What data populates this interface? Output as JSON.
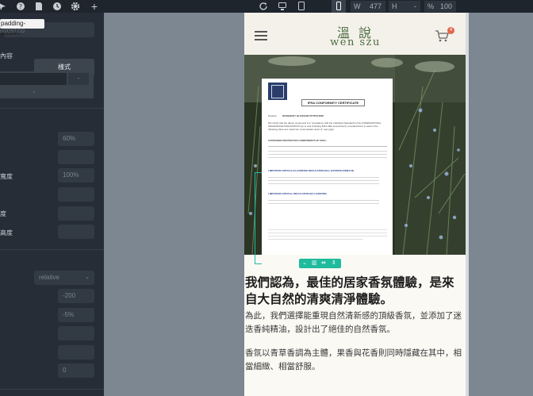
{
  "toolbar": {
    "icons": [
      "pointer-icon",
      "help-icon",
      "document-icon",
      "history-icon",
      "gear-icon",
      "add-icon",
      "refresh-icon",
      "desktop-icon",
      "tablet-icon",
      "mobile-icon"
    ],
    "width_label": "W",
    "width_value": "477",
    "height_label": "H",
    "height_value": "-",
    "zoom_label": "%",
    "zoom_value": "100"
  },
  "panel": {
    "tooltip": "padding-bottom",
    "tooltip_sub": "BOOST.CO",
    "content_label": "內容",
    "style_tab": "樣式",
    "inputs": {
      "input_1_value": "60%",
      "width_label": "寬度",
      "width_value": "100%",
      "label_4": "度",
      "height_label": "高度",
      "position_value": "relative",
      "value_a": "-200",
      "value_b": "-5%",
      "value_c": "0"
    }
  },
  "site": {
    "logo_cn": "溫 說",
    "logo_en": "wen szu",
    "cart_count": "4",
    "certificate": {
      "title": "IFRA CONFORMITY CERTIFICATE",
      "product_label": "Product:",
      "product": "ROSEMARY BLOSSOM POTPOURRI",
      "intro": "We certify that the above compound is in compliance with the published Standards of the INTERNATIONAL FRAGRANCE ASSOCIATION (up to and including IFRA 49th amendment), provided that it is used in the following class at a maximum concentration level of: max g/gm.",
      "components_title": "CONTAINED RESTRICTED COMPONENTS BY IFRA:",
      "section_1": "LIMITATION ARTICLE (CLASSIFIED REGULATION (EC) 1272/2008 ANNEX III)",
      "section_2": "LIMITATION ARTICLE, REGULATION (EC) 1223/2009"
    },
    "heading": "我們認為，最佳的居家香氛體驗，是來自大自然的清爽清淨體驗。",
    "para_1": "為此，我們選擇能重現自然清新感的頂級香氛，並添加了迷迭香純精油，設計出了絕佳的自然香氛。",
    "para_2": "香氛以青草香調為主體，果香與花香則同時隱藏在其中，相當細緻、相當舒服。"
  },
  "colors": {
    "toolbar_bg": "#1f252d",
    "panel_bg": "#262d36",
    "canvas_bg": "#7d8792",
    "accent": "#1fbb9d",
    "logo_green": "#4a6a3e",
    "badge": "#e0664b"
  }
}
